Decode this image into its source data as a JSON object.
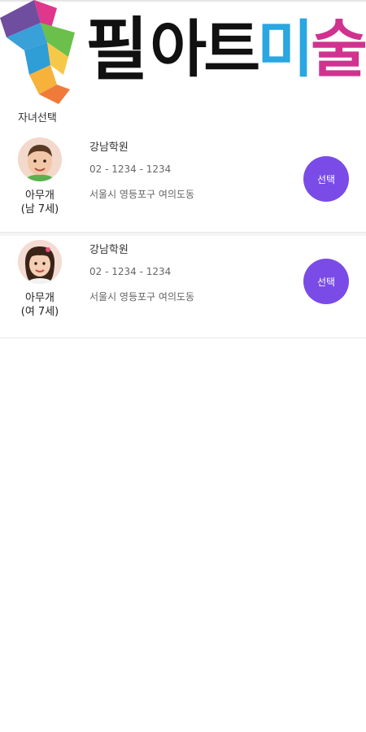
{
  "header": {
    "logo": {
      "part1": "필",
      "part2": "아",
      "part3": "트",
      "part4": "미",
      "part5": "술"
    },
    "section_title": "자녀선택"
  },
  "children": [
    {
      "name": "아무개",
      "meta": "(남 7세)",
      "academy": "강남학원",
      "phone": "02 - 1234 - 1234",
      "address": "서울시 영등포구 여의도동",
      "button_label": "선택"
    },
    {
      "name": "아무개",
      "meta": "(여 7세)",
      "academy": "강남학원",
      "phone": "02 - 1234 - 1234",
      "address": "서울시 영등포구 여의도동",
      "button_label": "선택"
    }
  ],
  "colors": {
    "accent": "#7a4be7",
    "logo_blue": "#2aa6e0",
    "logo_pink": "#d1328f"
  }
}
